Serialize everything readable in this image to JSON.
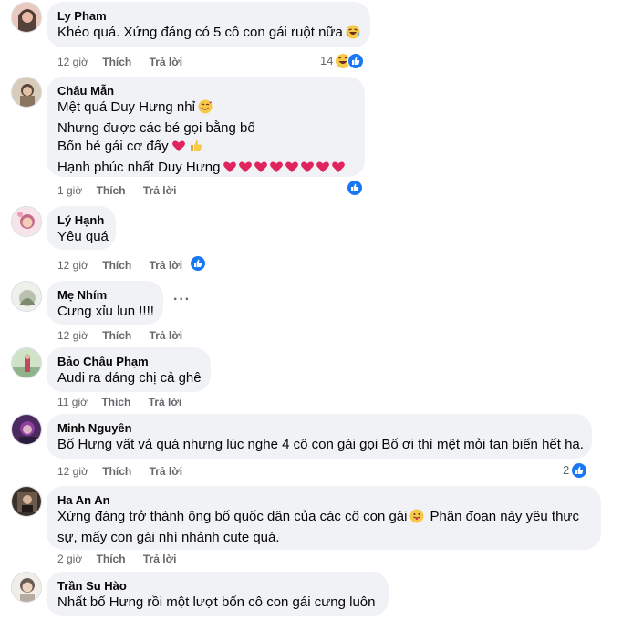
{
  "actions": {
    "like": "Thích",
    "reply": "Trả lời"
  },
  "comments": [
    {
      "author": "Ly Pham",
      "lines": [
        "Khéo quá. Xứng đáng có 5 cô con gái ruột nữa"
      ],
      "time": "12 giờ",
      "reaction_count": "14",
      "reactions": [
        "haha-icon",
        "like-icon"
      ],
      "avatar_colors": [
        "#c99a8a",
        "#3b2a25"
      ]
    },
    {
      "author": "Châu Mẫn",
      "lines": [
        "Mệt quá Duy Hưng nhỉ",
        "Nhưng được các bé gọi bằng bố",
        "Bốn bé gái cơ đấy",
        "Hạnh phúc nhất Duy Hưng"
      ],
      "time": "1 giờ",
      "reaction_count": "",
      "reactions": [
        "like-icon"
      ],
      "avatar_colors": [
        "#b8a48e",
        "#5a4637"
      ]
    },
    {
      "author": "Lý Hạnh",
      "lines": [
        "Yêu quá"
      ],
      "time": "12 giờ",
      "reaction_count": "",
      "reactions": [
        "like-icon"
      ],
      "avatar_colors": [
        "#f1d4dc",
        "#c66b86"
      ]
    },
    {
      "author": "Mẹ Nhím",
      "lines": [
        "Cưng xỉu lun !!!!"
      ],
      "time": "12 giờ",
      "reaction_count": "",
      "reactions": [],
      "more": "···",
      "avatar_colors": [
        "#d9dcd6",
        "#7c8a6e"
      ]
    },
    {
      "author": "Bảo Châu Phạm",
      "lines": [
        "Audi ra dáng chị cả ghê"
      ],
      "time": "11 giờ",
      "reaction_count": "",
      "reactions": [],
      "avatar_colors": [
        "#a7c5a0",
        "#c44a5a"
      ]
    },
    {
      "author": "Minh Nguyên",
      "lines": [
        "Bố Hưng vất vả quá nhưng lúc nghe 4 cô con gái gọi Bố ơi thì mệt mỏi tan biến hết ha."
      ],
      "time": "12 giờ",
      "reaction_count": "2",
      "reactions": [
        "like-icon"
      ],
      "avatar_colors": [
        "#8e3fa0",
        "#2b1b3d"
      ]
    },
    {
      "author": "Ha An An",
      "lines": [
        "Xứng đáng trở thành ông bố quốc dân của các cô con gái",
        "sự, mấy con gái nhí nhảnh cute quá."
      ],
      "inline_tail": "Phân đoạn này yêu thực",
      "time": "2 giờ",
      "reaction_count": "",
      "reactions": [],
      "avatar_colors": [
        "#6b5a4c",
        "#1f1a17"
      ]
    },
    {
      "author": "Trần Su Hào",
      "lines": [
        "Nhất bố Hưng rồi một lượt bốn cô con gái cưng luôn"
      ],
      "time": "",
      "reaction_count": "",
      "reactions": [],
      "avatar_colors": [
        "#e3ddd6",
        "#6b5b52"
      ]
    }
  ]
}
